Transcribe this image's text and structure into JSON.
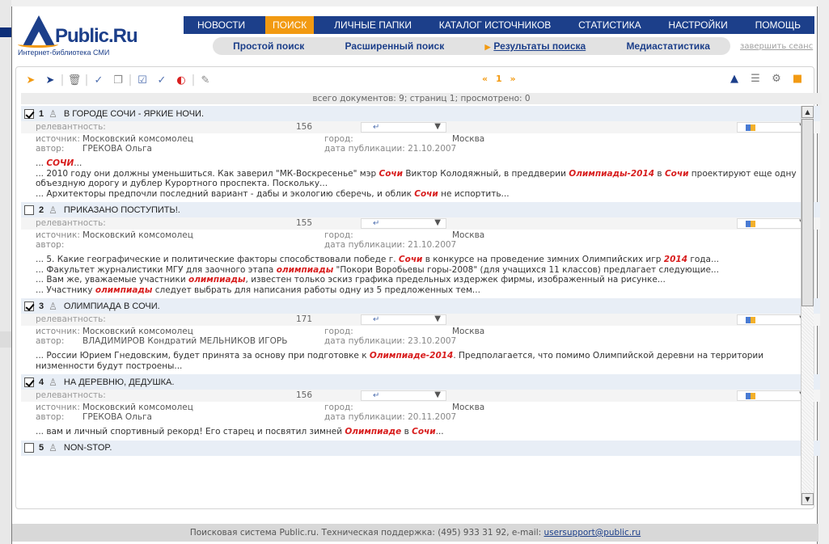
{
  "logo": {
    "text": "Public.Ru",
    "subtitle": "Интернет-библиотека СМИ"
  },
  "topnav": [
    "НОВОСТИ",
    "ПОИСК",
    "ЛИЧНЫЕ ПАПКИ",
    "КАТАЛОГ ИСТОЧНИКОВ",
    "СТАТИСТИКА",
    "НАСТРОЙКИ",
    "ПОМОЩЬ"
  ],
  "topnav_active": "ПОИСК",
  "subnav": [
    "Простой поиск",
    "Расширенный поиск",
    "Результаты поиска",
    "Медиастатистика"
  ],
  "subnav_current": "Результаты поиска",
  "logout": "завершить сеанс",
  "pager": {
    "prev": "«",
    "page": "1",
    "next": "»"
  },
  "stats": "всего документов: 9; страниц 1; просмотрено: 0",
  "labels": {
    "relevance": "релевантность:",
    "source": "источник:",
    "author": "автор:",
    "city": "город:",
    "pubdate": "дата публикации:"
  },
  "records": [
    {
      "num": "1",
      "checked": true,
      "title": "В ГОРОДЕ СОЧИ - ЯРКИЕ НОЧИ.",
      "relevance": "156",
      "source": "Московский комсомолец",
      "author": "ГРЕКОВА Ольга",
      "city": "Москва",
      "date": "21.10.2007",
      "snippets": [
        [
          {
            "t": "... "
          },
          {
            "t": "СОЧИ",
            "h": true
          },
          {
            "t": "..."
          }
        ],
        [
          {
            "t": "... 2010 году они должны уменьшиться. Как заверил \"МК-Воскресенье\" мэр "
          },
          {
            "t": "Сочи",
            "h": true
          },
          {
            "t": " Виктор Колодяжный, в преддверии "
          },
          {
            "t": "Олимпиады-2014",
            "h": true
          },
          {
            "t": " в "
          },
          {
            "t": "Сочи",
            "h": true
          },
          {
            "t": " проектируют еще одну объездную дорогу и дублер Курортного проспекта. Поскольку..."
          }
        ],
        [
          {
            "t": "... Архитекторы предпочли последний вариант - дабы и экологию сберечь, и облик "
          },
          {
            "t": "Сочи",
            "h": true
          },
          {
            "t": " не испортить..."
          }
        ]
      ]
    },
    {
      "num": "2",
      "checked": false,
      "title": "ПРИКАЗАНО ПОСТУПИТЬ!.",
      "relevance": "155",
      "source": "Московский комсомолец",
      "author": "",
      "city": "Москва",
      "date": "21.10.2007",
      "snippets": [
        [
          {
            "t": "... 5. Какие географические и политические факторы способствовали победе г. "
          },
          {
            "t": "Сочи",
            "h": true
          },
          {
            "t": " в конкурсе на проведение зимних Олимпийских игр "
          },
          {
            "t": "2014",
            "h": true
          },
          {
            "t": " года..."
          }
        ],
        [
          {
            "t": "... Факультет журналистики МГУ для заочного этапа "
          },
          {
            "t": "олимпиады",
            "h": true
          },
          {
            "t": " \"Покори Воробьевы горы-2008\" (для учащихся 11 классов) предлагает следующие..."
          }
        ],
        [
          {
            "t": "... Вам же, уважаемые участники "
          },
          {
            "t": "олимпиады",
            "h": true
          },
          {
            "t": ", известен только эскиз графика предельных издержек фирмы, изображенный на рисунке..."
          }
        ],
        [
          {
            "t": "... Участнику "
          },
          {
            "t": "олимпиады",
            "h": true
          },
          {
            "t": " следует выбрать для написания работы одну из 5 предложенных тем..."
          }
        ]
      ]
    },
    {
      "num": "3",
      "checked": true,
      "title": "ОЛИМПИАДА В СОЧИ.",
      "relevance": "171",
      "source": "Московский комсомолец",
      "author": "ВЛАДИМИРОВ Кондратий МЕЛЬНИКОВ ИГОРЬ",
      "city": "Москва",
      "date": "23.10.2007",
      "snippets": [
        [
          {
            "t": "... России Юрием Гнедовским, будет принята за основу при подготовке к "
          },
          {
            "t": "Олимпиаде-2014",
            "h": true
          },
          {
            "t": ". Предполагается, что помимо Олимпийской деревни на территории низменности будут построены..."
          }
        ]
      ]
    },
    {
      "num": "4",
      "checked": true,
      "title": "НА ДЕРЕВНЮ, ДЕДУШКА.",
      "relevance": "156",
      "source": "Московский комсомолец",
      "author": "ГРЕКОВА Ольга",
      "city": "Москва",
      "date": "20.11.2007",
      "snippets": [
        [
          {
            "t": "... вам и личный спортивный рекорд! Его старец и посвятил зимней "
          },
          {
            "t": "Олимпиаде",
            "h": true
          },
          {
            "t": " в "
          },
          {
            "t": "Сочи",
            "h": true
          },
          {
            "t": "..."
          }
        ]
      ]
    },
    {
      "num": "5",
      "checked": false,
      "title": "NON-STOP.",
      "relevance": "",
      "source": "",
      "author": "",
      "city": "",
      "date": "",
      "snippets": []
    }
  ],
  "footer": {
    "text": "Поисковая система Public.ru. Техническая поддержка: (495) 933 31 92, e-mail: ",
    "email": "usersupport@public.ru"
  },
  "colors": {
    "brand": "#1c3f8a",
    "accent": "#f29a12",
    "highlight": "#d81e1e"
  }
}
